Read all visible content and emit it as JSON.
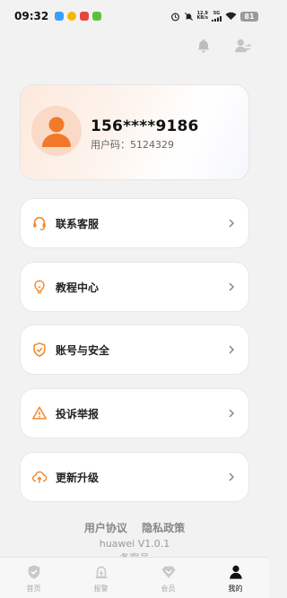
{
  "status_bar": {
    "time": "09:32",
    "net_speed_value": "12.9",
    "net_speed_unit": "KB/s",
    "network": "5G",
    "battery": "81"
  },
  "profile": {
    "phone": "156****9186",
    "user_code": "用户码：5124329"
  },
  "menu": [
    {
      "label": "联系客服",
      "icon": "headset-icon"
    },
    {
      "label": "教程中心",
      "icon": "lightbulb-icon"
    },
    {
      "label": "账号与安全",
      "icon": "shield-check-icon"
    },
    {
      "label": "投诉举报",
      "icon": "warning-icon"
    },
    {
      "label": "更新升级",
      "icon": "cloud-upload-icon"
    }
  ],
  "footer": {
    "user_agreement": "用户协议",
    "privacy_policy": "隐私政策",
    "version": "huawei V1.0.1",
    "beian": "备案号"
  },
  "tabs": [
    {
      "label": "首页",
      "icon": "shield-icon",
      "active": false
    },
    {
      "label": "报警",
      "icon": "alarm-icon",
      "active": false
    },
    {
      "label": "会员",
      "icon": "diamond-icon",
      "active": false
    },
    {
      "label": "我的",
      "icon": "person-icon",
      "active": true
    }
  ],
  "colors": {
    "accent": "#f08a2e",
    "background": "#f2f2f2",
    "tab_inactive": "#aaaaaa",
    "tab_active": "#111111"
  }
}
